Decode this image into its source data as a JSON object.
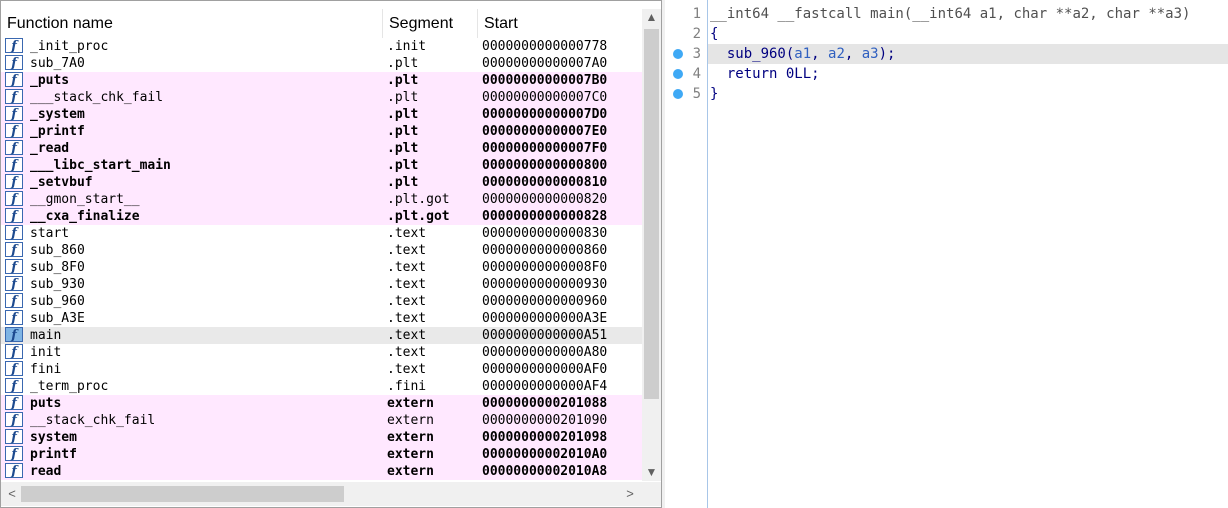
{
  "functions_window": {
    "columns": {
      "name": "Function name",
      "segment": "Segment",
      "start": "Start"
    },
    "icon_glyph": "f",
    "rows": [
      {
        "name": "_init_proc",
        "segment": ".init",
        "start": "0000000000000778",
        "style": "normal"
      },
      {
        "name": "sub_7A0",
        "segment": ".plt",
        "start": "00000000000007A0",
        "style": "normal"
      },
      {
        "name": "_puts",
        "segment": ".plt",
        "start": "00000000000007B0",
        "style": "lib-bold"
      },
      {
        "name": "___stack_chk_fail",
        "segment": ".plt",
        "start": "00000000000007C0",
        "style": "lib"
      },
      {
        "name": "_system",
        "segment": ".plt",
        "start": "00000000000007D0",
        "style": "lib-bold"
      },
      {
        "name": "_printf",
        "segment": ".plt",
        "start": "00000000000007E0",
        "style": "lib-bold"
      },
      {
        "name": "_read",
        "segment": ".plt",
        "start": "00000000000007F0",
        "style": "lib-bold"
      },
      {
        "name": "___libc_start_main",
        "segment": ".plt",
        "start": "0000000000000800",
        "style": "lib-bold"
      },
      {
        "name": "_setvbuf",
        "segment": ".plt",
        "start": "0000000000000810",
        "style": "lib-bold"
      },
      {
        "name": "__gmon_start__",
        "segment": ".plt.got",
        "start": "0000000000000820",
        "style": "lib"
      },
      {
        "name": "__cxa_finalize",
        "segment": ".plt.got",
        "start": "0000000000000828",
        "style": "lib-bold"
      },
      {
        "name": "start",
        "segment": ".text",
        "start": "0000000000000830",
        "style": "normal"
      },
      {
        "name": "sub_860",
        "segment": ".text",
        "start": "0000000000000860",
        "style": "normal"
      },
      {
        "name": "sub_8F0",
        "segment": ".text",
        "start": "00000000000008F0",
        "style": "normal"
      },
      {
        "name": "sub_930",
        "segment": ".text",
        "start": "0000000000000930",
        "style": "normal"
      },
      {
        "name": "sub_960",
        "segment": ".text",
        "start": "0000000000000960",
        "style": "normal"
      },
      {
        "name": "sub_A3E",
        "segment": ".text",
        "start": "0000000000000A3E",
        "style": "normal"
      },
      {
        "name": "main",
        "segment": ".text",
        "start": "0000000000000A51",
        "style": "selected"
      },
      {
        "name": "init",
        "segment": ".text",
        "start": "0000000000000A80",
        "style": "normal"
      },
      {
        "name": "fini",
        "segment": ".text",
        "start": "0000000000000AF0",
        "style": "normal"
      },
      {
        "name": "_term_proc",
        "segment": ".fini",
        "start": "0000000000000AF4",
        "style": "normal"
      },
      {
        "name": "puts",
        "segment": "extern",
        "start": "0000000000201088",
        "style": "lib-bold"
      },
      {
        "name": "__stack_chk_fail",
        "segment": "extern",
        "start": "0000000000201090",
        "style": "lib"
      },
      {
        "name": "system",
        "segment": "extern",
        "start": "0000000000201098",
        "style": "lib-bold"
      },
      {
        "name": "printf",
        "segment": "extern",
        "start": "00000000002010A0",
        "style": "lib-bold"
      },
      {
        "name": "read",
        "segment": "extern",
        "start": "00000000002010A8",
        "style": "lib-bold"
      }
    ]
  },
  "pseudocode_window": {
    "lines": [
      {
        "num": "1",
        "breakpoint": false,
        "current": false,
        "tokens": [
          {
            "t": "__int64 __fastcall main(",
            "c": "type"
          },
          {
            "t": "__int64 a1, ",
            "c": "type"
          },
          {
            "t": "char **a2, ",
            "c": "type"
          },
          {
            "t": "char **a3)",
            "c": "type"
          }
        ]
      },
      {
        "num": "2",
        "breakpoint": false,
        "current": false,
        "tokens": [
          {
            "t": "{",
            "c": "plain"
          }
        ]
      },
      {
        "num": "3",
        "breakpoint": true,
        "current": true,
        "tokens": [
          {
            "t": "  sub_960(",
            "c": "plain"
          },
          {
            "t": "a1",
            "c": "arg"
          },
          {
            "t": ", ",
            "c": "plain"
          },
          {
            "t": "a2",
            "c": "arg"
          },
          {
            "t": ", ",
            "c": "plain"
          },
          {
            "t": "a3",
            "c": "arg"
          },
          {
            "t": ");",
            "c": "plain"
          }
        ]
      },
      {
        "num": "4",
        "breakpoint": true,
        "current": false,
        "tokens": [
          {
            "t": "  return 0LL;",
            "c": "plain"
          }
        ]
      },
      {
        "num": "5",
        "breakpoint": true,
        "current": false,
        "tokens": [
          {
            "t": "}",
            "c": "plain"
          }
        ]
      }
    ]
  },
  "scrollbar": {
    "up_arrow": "▲",
    "down_arrow": "▼",
    "left_arrow": "<",
    "right_arrow": ">"
  },
  "colors": {
    "library_row_bg": "#ffe8ff",
    "selected_row_bg": "#e9e9e9",
    "breakpoint_dot": "#3fa9f5",
    "current_line_bg": "#e5e5e5",
    "keyword_color": "#505050",
    "code_color": "#000080",
    "arg_color": "#3060c0"
  }
}
